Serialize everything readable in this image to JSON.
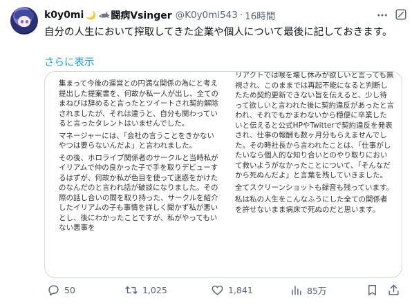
{
  "author": {
    "display_name": "k0y0mi",
    "name_suffix": "🌙",
    "tag": "闘病Vsinger",
    "handle": "@K0y0mi543",
    "separator": "·",
    "time": "16時間"
  },
  "post": {
    "text": "自分の人生において搾取してきた企業や個人について最後に記しておきます。",
    "show_more": "さらに表示"
  },
  "media": {
    "left_panel": [
      "集まって今後の運営との円満な関係の為にと考え提出した提案書を、何故か私一人が出し、全てのまねびは辞めると言ったとツイートされ契約解除されましたが、それは違うと、自分も関わっていると言ったタレントはいませんでした。",
      "マネージャーには、「会社の言うことをきかないやつは要らないんだよ」と言われました。",
      "その後、ホロライブ関係者のサークルと当時私がイリアムで仲の良かった子で手を取りデビューするはずが、何故か私が色目を使って迷惑をかけたのなんだのと言われ話が破談になりました。その際の話し合いの間を取り持った、サークルを紹介したイリアムの子も事情を詳しく聞かず私が悪いとし、後にわかったことですが、私がやってもいない悪事を"
    ],
    "right_panel": [
      "リアクトでは喉を壊し休みが欲しいと言っても無視され、このままでは再起不能になると判断したため契約更新できない旨を伝えると、少し待って欲しいと言われた後に契約違反があったと言われ、それでもかまわないから穏便に卒業したいと伝えると公式HPやTwitterで契約違反を発表され、仕事の報酬も数ヶ月分もらえませんでした。その時社長から言われたことは、「仕事がしたいなら個人的な知り合いとのやり取りにおいて救いようがなかったことについて、「そんなだから死ぬんだよ」と言葉を残していきました。",
      "全てスクリーンショットも録音も残っています。",
      "私は私の人生をこんなふうにした全ての関係者を許せないまま病床で死ぬのだと思います。"
    ]
  },
  "actions": {
    "replies": "50",
    "retweets": "1,025",
    "likes": "1,841",
    "views": "85万"
  },
  "icons": {
    "more": "more-icon",
    "grok": "grok-icon",
    "reply": "reply-icon",
    "retweet": "retweet-icon",
    "like": "heart-icon",
    "views": "analytics-icon",
    "bookmark": "bookmark-icon",
    "share": "share-icon"
  },
  "colors": {
    "link": "#1d9bf0",
    "secondary_text": "#536471",
    "border": "#cfd9de"
  }
}
